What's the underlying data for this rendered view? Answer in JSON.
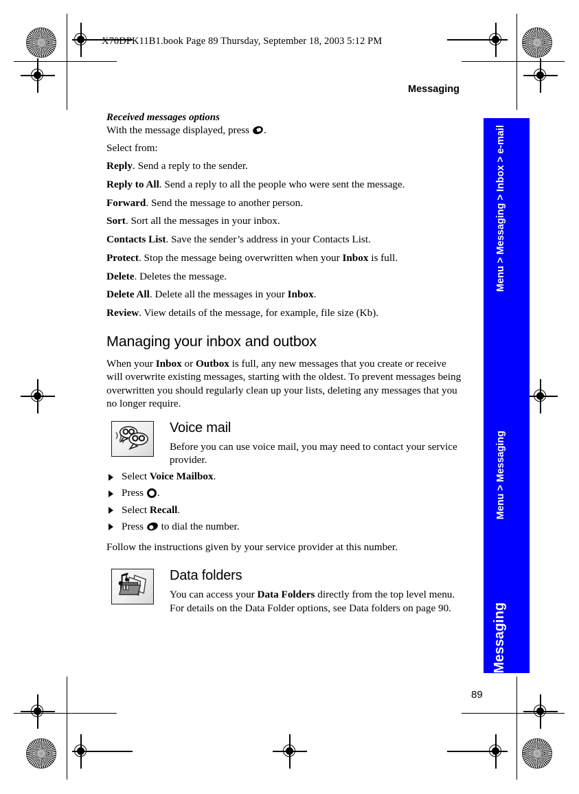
{
  "print_marks": {
    "file_info": "X70DPK11B1.book  Page 89  Thursday, September 18, 2003  5:12 PM"
  },
  "header": {
    "running_head": "Messaging"
  },
  "footer": {
    "page_number": "89"
  },
  "nav_sidebar": {
    "color": "#0000ff",
    "breadcrumb_top": "Menu > Messaging > Inbox > e-mail",
    "breadcrumb_mid": "Menu > Messaging",
    "chapter": "Messaging"
  },
  "content": {
    "subhead": "Received messages options",
    "intro_before_key": "With the message displayed, press",
    "intro_after_key": ".",
    "select_from": "Select from:",
    "options": [
      {
        "term": "Reply",
        "desc": ". Send a reply to the sender."
      },
      {
        "term": "Reply to All",
        "desc": ". Send a reply to all the people who were sent the message."
      },
      {
        "term": "Forward",
        "desc": ". Send the message to another person."
      },
      {
        "term": "Sort",
        "desc": ". Sort all the messages in your inbox."
      },
      {
        "term": "Contacts List",
        "desc": ". Save the sender’s address in your Contacts List."
      },
      {
        "term": "Protect",
        "desc_pre": ". Stop the message being overwritten when your ",
        "bold_inline": "Inbox",
        "desc_post": " is full."
      },
      {
        "term": "Delete",
        "desc": ". Deletes the message."
      },
      {
        "term": "Delete All",
        "desc_pre": ". Delete all the messages in your ",
        "bold_inline": "Inbox",
        "desc_post": "."
      },
      {
        "term": "Review",
        "desc": ". View details of the message, for example, file size (Kb)."
      }
    ],
    "section_heading": "Managing your inbox and outbox",
    "section_para_1": "When your ",
    "section_para_bold_1": "Inbox",
    "section_para_2": " or ",
    "section_para_bold_2": "Outbox",
    "section_para_3": " is full, any new messages that you create or receive will overwrite existing messages, starting with the oldest. To prevent messages being overwritten you should regularly clean up your lists, deleting any messages that you no longer require.",
    "voice_mail": {
      "icon": "speech-bubbles-icon",
      "title": "Voice mail",
      "body": "Before you can use voice mail, you may need to contact your service provider.",
      "steps": [
        {
          "pre": "Select ",
          "bold": "Voice Mailbox",
          "post": "."
        },
        {
          "pre": "Press ",
          "key": "navigation-key-icon",
          "post": "."
        },
        {
          "pre": "Select ",
          "bold": "Recall",
          "post": "."
        },
        {
          "pre": "Press ",
          "key": "call-key-icon",
          "post": " to dial the number."
        }
      ],
      "follow_up": "Follow the instructions given by your service provider at this number."
    },
    "data_folders": {
      "icon": "folder-music-icon",
      "title": "Data folders",
      "body_pre": "You can access your ",
      "body_bold": "Data Folders",
      "body_post": " directly from the top level menu. For details on the Data Folder options, see Data folders on page 90."
    }
  }
}
